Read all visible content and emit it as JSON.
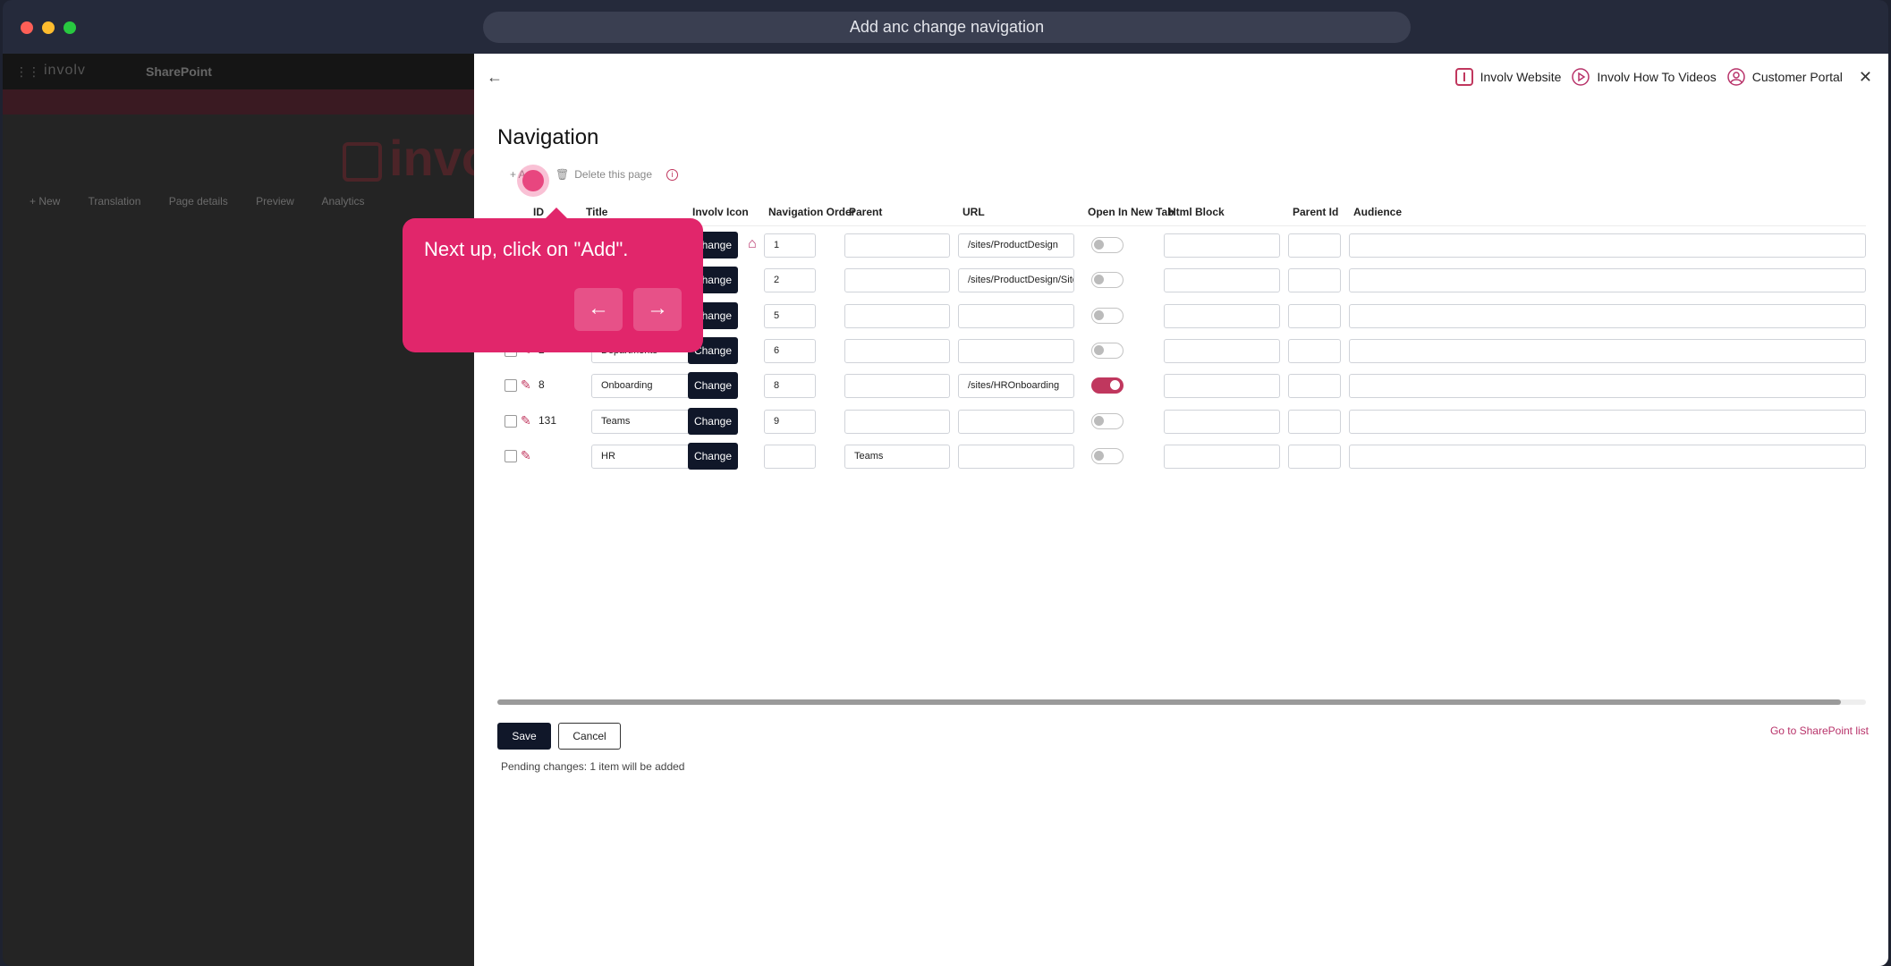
{
  "window": {
    "title": "Add anc change navigation"
  },
  "background": {
    "logo": "involv",
    "site_name": "SharePoint",
    "big_logo": "invo",
    "commands": [
      "+ New",
      "Translation",
      "Page details",
      "Preview",
      "Analytics"
    ]
  },
  "toplinks": [
    {
      "label": "Involv Website",
      "icon": "involv-logo-icon"
    },
    {
      "label": "Involv How To Videos",
      "icon": "play-circle-icon"
    },
    {
      "label": "Customer Portal",
      "icon": "user-circle-icon"
    }
  ],
  "page": {
    "title": "Navigation",
    "add_label": "+ Add",
    "delete_label": "Delete this page"
  },
  "columns": [
    "ID",
    "Title",
    "Involv Icon",
    "Navigation Order",
    "Parent",
    "URL",
    "Open In New Tab",
    "Html Block",
    "Parent Id",
    "Audience"
  ],
  "change_label": "Change",
  "rows": [
    {
      "id": "",
      "title": "",
      "order": "1",
      "parent": "",
      "url": "/sites/ProductDesign",
      "new_tab": false
    },
    {
      "id": "",
      "title": "",
      "order": "2",
      "parent": "",
      "url": "/sites/ProductDesign/SitePag",
      "new_tab": false
    },
    {
      "id": "",
      "title": "",
      "order": "5",
      "parent": "",
      "url": "",
      "new_tab": false
    },
    {
      "id": "2",
      "title": "Departments",
      "order": "6",
      "parent": "",
      "url": "",
      "new_tab": false
    },
    {
      "id": "8",
      "title": "Onboarding",
      "order": "8",
      "parent": "",
      "url": "/sites/HROnboarding",
      "new_tab": true
    },
    {
      "id": "131",
      "title": "Teams",
      "order": "9",
      "parent": "",
      "url": "",
      "new_tab": false
    },
    {
      "id": "",
      "title": "HR",
      "order": "",
      "parent": "Teams",
      "url": "",
      "new_tab": false
    }
  ],
  "footer": {
    "save": "Save",
    "cancel": "Cancel",
    "pending": "Pending changes: 1 item will be added",
    "go_link": "Go to SharePoint list"
  },
  "tooltip": {
    "text": "Next up, click on \"Add\".",
    "prev": "←",
    "next": "→"
  },
  "colors": {
    "accent": "#e1266b",
    "dark_button": "#101729",
    "link": "#b8336a"
  }
}
